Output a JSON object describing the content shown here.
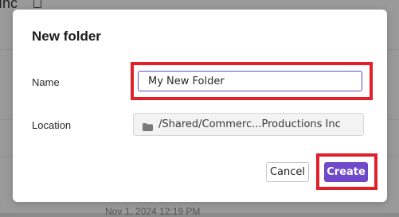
{
  "background": {
    "title_fragment": "Inc",
    "date_fragment": "Nov 1, 2024 12:19 PM"
  },
  "dialog": {
    "title": "New folder",
    "name_label": "Name",
    "name_value": "My New Folder",
    "location_label": "Location",
    "location_value": "/Shared/Commerc...Productions Inc",
    "cancel_label": "Cancel",
    "create_label": "Create"
  },
  "colors": {
    "accent": "#6f49c9",
    "highlight": "#e0202a"
  },
  "icons": {
    "location": "folder-icon"
  }
}
